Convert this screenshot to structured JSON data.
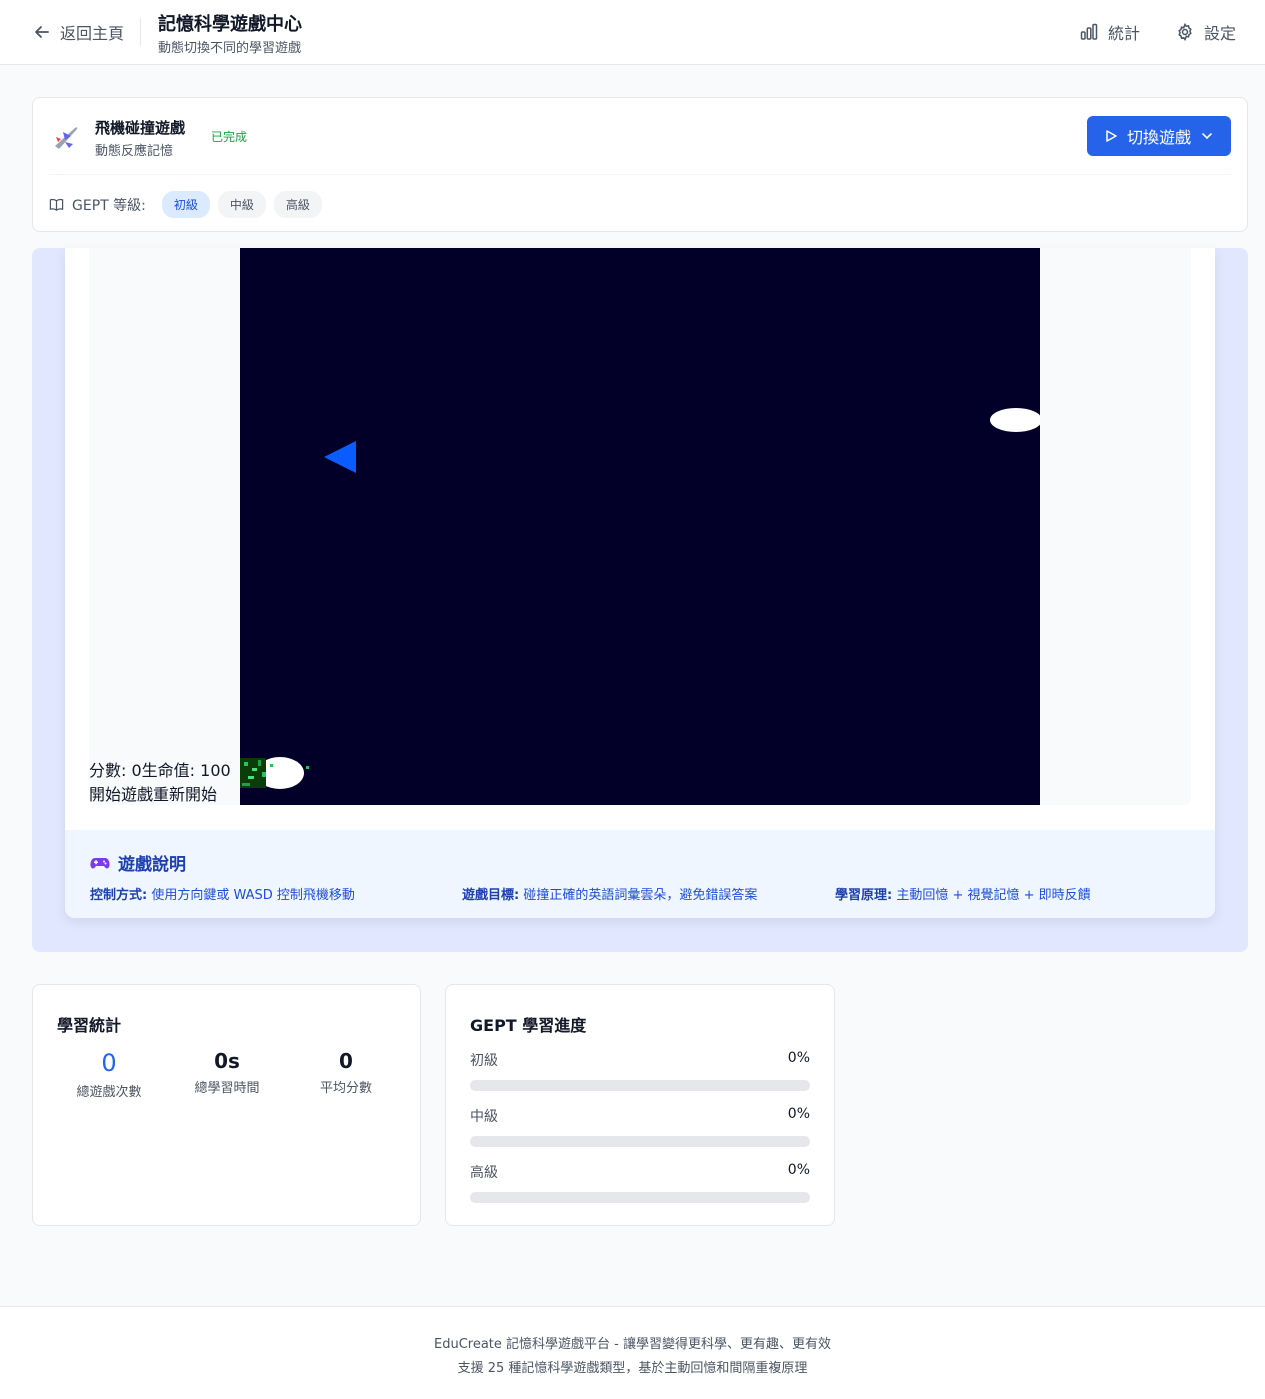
{
  "header": {
    "back_label": "返回主頁",
    "title": "記憶科學遊戲中心",
    "subtitle": "動態切換不同的學習遊戲",
    "stats_label": "統計",
    "settings_label": "設定"
  },
  "game_info": {
    "name": "飛機碰撞遊戲",
    "type": "動態反應記憶",
    "status": "已完成",
    "switch_label": "切換遊戲",
    "gept_label": "GEPT 等級:",
    "levels": [
      "初級",
      "中級",
      "高級"
    ],
    "active_level": "初級"
  },
  "game": {
    "hud_score": "分數: 0",
    "hud_life": "生命值: 100",
    "start_label": "開始遊戲",
    "restart_label": "重新開始"
  },
  "instructions": {
    "title": "遊戲說明",
    "control_label": "控制方式:",
    "control_text": "使用方向鍵或 WASD 控制飛機移動",
    "goal_label": "遊戲目標:",
    "goal_text": "碰撞正確的英語詞彙雲朵，避免錯誤答案",
    "principle_label": "學習原理:",
    "principle_text": "主動回憶 + 視覺記憶 + 即時反饋"
  },
  "learning_stats": {
    "title": "學習統計",
    "items": [
      {
        "value": "0",
        "label": "總遊戲次數"
      },
      {
        "value": "0s",
        "label": "總學習時間"
      },
      {
        "value": "0",
        "label": "平均分數"
      }
    ]
  },
  "gept_progress": {
    "title": "GEPT 學習進度",
    "rows": [
      {
        "label": "初級",
        "percent": "0%",
        "value": 0
      },
      {
        "label": "中級",
        "percent": "0%",
        "value": 0
      },
      {
        "label": "高級",
        "percent": "0%",
        "value": 0
      }
    ]
  },
  "footer": {
    "line1": "EduCreate 記憶科學遊戲平台 - 讓學習變得更科學、更有趣、更有效",
    "line2": "支援 25 種記憶科學遊戲類型，基於主動回憶和間隔重複原理"
  },
  "colors": {
    "accent": "#2563eb",
    "canvas_bg": "#020029",
    "player": "#0a5cff",
    "success": "#16a34a"
  }
}
